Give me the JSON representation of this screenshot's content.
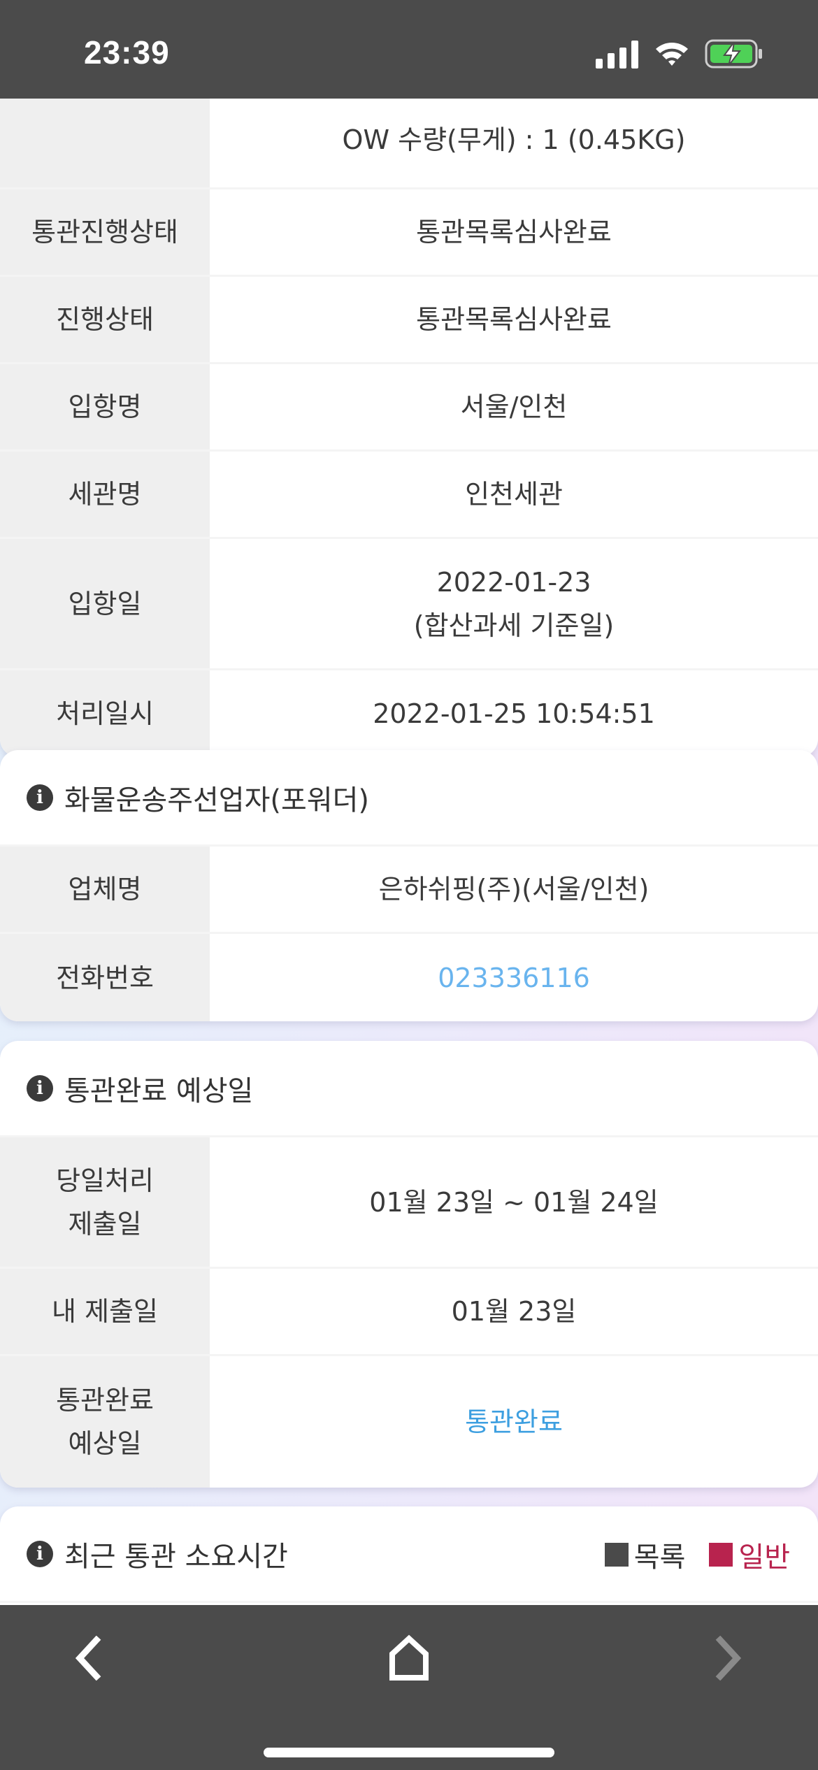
{
  "status": {
    "time": "23:39"
  },
  "card1": {
    "rows": [
      {
        "label": "",
        "value": "OW 수량(무게) : 1 (0.45KG)"
      },
      {
        "label": "통관진행상태",
        "value": "통관목록심사완료"
      },
      {
        "label": "진행상태",
        "value": "통관목록심사완료"
      },
      {
        "label": "입항명",
        "value": "서울/인천"
      },
      {
        "label": "세관명",
        "value": "인천세관"
      },
      {
        "label": "입항일",
        "value": "2022-01-23",
        "value2": "(합산과세 기준일)"
      },
      {
        "label": "처리일시",
        "value": "2022-01-25 10:54:51"
      }
    ]
  },
  "card2": {
    "title": "화물운송주선업자(포워더)",
    "rows": [
      {
        "label": "업체명",
        "value": "은하쉬핑(주)(서울/인천)"
      },
      {
        "label": "전화번호",
        "value": "023336116"
      }
    ]
  },
  "card3": {
    "title": "통관완료 예상일",
    "rows": [
      {
        "label1": "당일처리",
        "label2": "제출일",
        "value": "01월 23일 ~ 01월 24일"
      },
      {
        "label": "내 제출일",
        "value": "01월 23일"
      },
      {
        "label1": "통관완료",
        "label2": "예상일",
        "value": "통관완료"
      }
    ]
  },
  "card4": {
    "title": "최근 통관 소요시간",
    "legend": [
      {
        "label": "목록",
        "color": "#4a4a4a"
      },
      {
        "label": "일반",
        "color": "#b8234e"
      }
    ]
  },
  "colors": {
    "bars": "#4b4b4b",
    "link": "#69b4ee",
    "accent": "#3d9fe0"
  },
  "icons": [
    "signal-icon",
    "wifi-icon",
    "battery-charging-icon",
    "info-icon",
    "back-arrow-icon",
    "home-icon",
    "forward-arrow-icon"
  ]
}
